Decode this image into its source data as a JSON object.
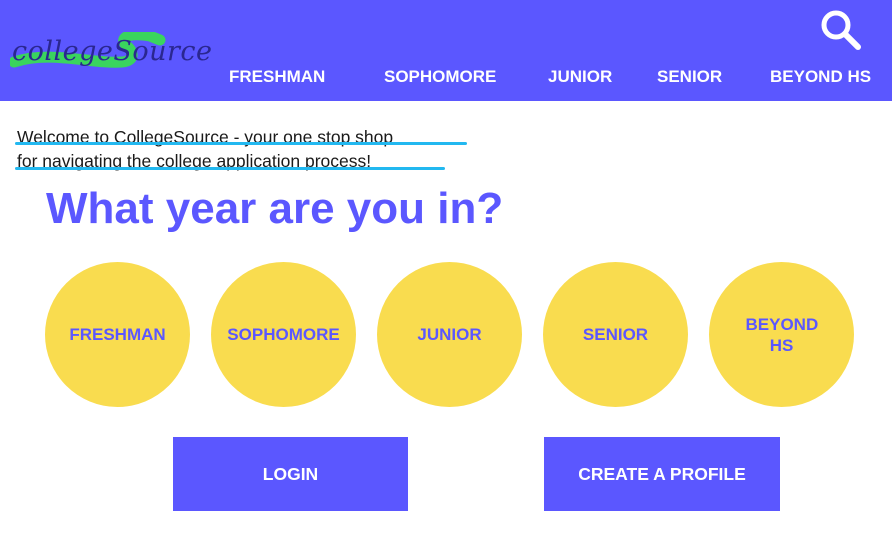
{
  "header": {
    "logo_text": "collegeSource",
    "search_icon": "search-icon",
    "nav": [
      {
        "label": "FRESHMAN"
      },
      {
        "label": "SOPHOMORE"
      },
      {
        "label": "JUNIOR"
      },
      {
        "label": "SENIOR"
      },
      {
        "label": "BEYOND HS"
      }
    ]
  },
  "welcome": {
    "line1": "Welcome to CollegeSource - your one stop shop",
    "line2": "for navigating the college application process!"
  },
  "question": "What year are you in?",
  "years": [
    {
      "label": "FRESHMAN"
    },
    {
      "label": "SOPHOMORE"
    },
    {
      "label": "JUNIOR"
    },
    {
      "label": "SENIOR"
    },
    {
      "label": "BEYOND HS"
    }
  ],
  "actions": {
    "login_label": "LOGIN",
    "create_profile_label": "CREATE A PROFILE"
  },
  "colors": {
    "primary": "#5b57ff",
    "accent_yellow": "#f9dc4f",
    "logo_swoosh": "#3ad45e",
    "underline": "#22b8f0"
  }
}
